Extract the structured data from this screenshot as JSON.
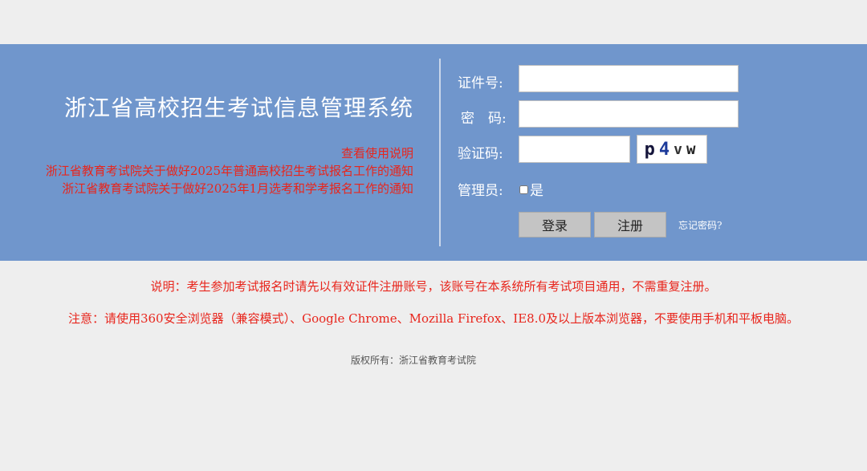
{
  "header": {
    "title": "浙江省高校招生考试信息管理系统",
    "links": [
      "查看使用说明",
      "浙江省教育考试院关于做好2025年普通高校招生考试报名工作的通知",
      "浙江省教育考试院关于做好2025年1月选考和学考报名工作的通知"
    ]
  },
  "login_form": {
    "id_label": "证件号:",
    "id_value": "",
    "password_label": "密　码:",
    "password_value": "",
    "captcha_label": "验证码:",
    "captcha_value": "",
    "captcha_chars": [
      "p",
      "4",
      "v",
      "w"
    ],
    "admin_label": "管理员:",
    "admin_option": "是",
    "admin_checked": false,
    "login_button": "登录",
    "register_button": "注册",
    "forgot_link": "忘记密码?"
  },
  "notices": {
    "note1": "说明：考生参加考试报名时请先以有效证件注册账号，该账号在本系统所有考试项目通用，不需重复注册。",
    "note2": "注意：请使用360安全浏览器（兼容模式）、Google Chrome、Mozilla Firefox、IE8.0及以上版本浏览器，不要使用手机和平板电脑。"
  },
  "footer": {
    "copyright": "版权所有：浙江省教育考试院"
  },
  "colors": {
    "banner": "#7096cc",
    "page_bg": "#eeeeee",
    "link_red": "#e8251c",
    "button_gray": "#c4c4c4"
  }
}
